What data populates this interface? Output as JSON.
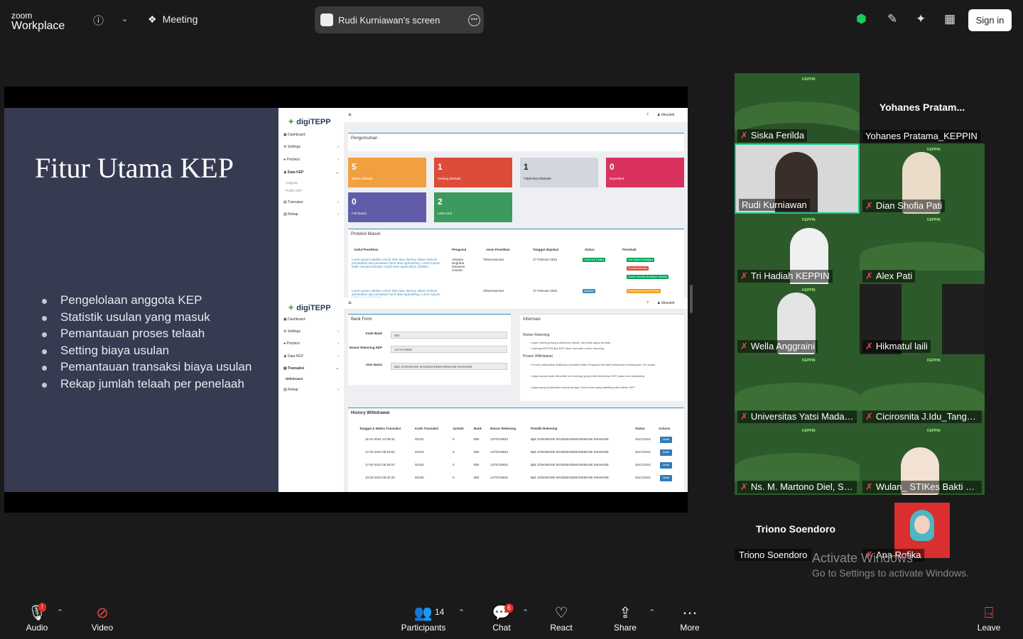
{
  "app": {
    "logo_top": "zoom",
    "logo_bottom": "Workplace"
  },
  "header": {
    "meeting_label": "Meeting",
    "screen_share_label": "Rudi Kurniawan's screen",
    "sign_in": "Sign in"
  },
  "colors": {
    "accent_green": "#1ec95a",
    "active_border": "#20c997",
    "tile_orange": "#f0a040",
    "tile_red": "#dd4b39",
    "tile_gray": "#d2d6de",
    "tile_pink": "#d9325f",
    "tile_purple": "#605ca8",
    "tile_green": "#3c9a5f"
  },
  "slide": {
    "title": "Fitur Utama KEP",
    "bullets": [
      "Pengelolaan anggota KEP",
      "Statistik usulan yang masuk",
      "Pemantauan proses telaah",
      "Setting biaya usulan",
      "Pemantauan transaksi biaya usulan",
      "Rekap jumlah telaah per penelaah"
    ]
  },
  "app1": {
    "brand": "digiTEPP",
    "user": "dinustek",
    "help": "?",
    "nav": [
      "Dashboard",
      "Settings",
      "Protokol",
      "Data KEP",
      "Transaksi",
      "Rekap"
    ],
    "subnav": [
      "Anggota",
      "Profile KEP"
    ],
    "announcement": "Pengumuman",
    "stats": [
      {
        "value": "5",
        "label": "Belum ditelaah"
      },
      {
        "value": "1",
        "label": "Sedang ditelaah"
      },
      {
        "value": "1",
        "label": "Tidak Bisa Ditelaah"
      },
      {
        "value": "0",
        "label": "Expedited"
      },
      {
        "value": "0",
        "label": "Full Board"
      },
      {
        "value": "2",
        "label": "Lolos SLE"
      }
    ],
    "protocol_title": "Protokol Masuk",
    "columns": [
      "Judul Penelitian",
      "Pengusul",
      "Jenis Penelitian",
      "Tanggal diajukan",
      "Status",
      "Penelaah"
    ],
    "rows": [
      {
        "judul": "Lorem ipsum adalah contoh teks atau dummy dalam industri percetakan dan penataan huruf atau typesetting. Lorem Ipsum telah menjadi standar contoh teks sejak tahun 1500an,",
        "pengusul": "Abiyasa Nugraha Siswanto Candra",
        "jenis": "Observasional",
        "tanggal": "17 Februari 2024",
        "status": "Lolos SLE (Telah)",
        "penelaah": [
          "Joko Nijanto Branijaya",
          "Eunanda Birdana",
          "Guntur Gumelar Branijaya Laksana"
        ]
      },
      {
        "judul": "Lorem ipsum adalah contoh teks atau dummy dalam industri percetakan dan penataan huruf atau typesetting. Lorem Ipsum telah menjadi standar",
        "pengusul": "",
        "jenis": "Observasional",
        "tanggal": "17 Februari 2024",
        "status": "Diajukan",
        "penelaah": [
          "Penetapak Belum Di Ploting"
        ]
      }
    ]
  },
  "app2": {
    "brand": "digiTEPP",
    "user": "dinustek",
    "help": "?",
    "nav": [
      "Dashboard",
      "Settings",
      "Protokol",
      "Data KEP",
      "Transaksi",
      "Rekap"
    ],
    "subnav": [
      "Withdrawal"
    ],
    "bank_form": {
      "title": "Bank Form",
      "kode_bank_label": "Kode Bank",
      "kode_bank_value": "BNI",
      "rekening_label": "Nomor Rekening KEP",
      "rekening_value": "1275719933",
      "atas_nama_label": "Atas Nama",
      "atas_nama_value": "Bpk JONOMADE MADEMADEMADEMADE IMAMADE"
    },
    "info": {
      "title": "Informasi",
      "rekening_heading": "Nomor Rekening",
      "rekening_points": [
        "Input rekening hanya dilakukan sekali, dan tidak dapat dirubah",
        "hubungi KEPPIN jika KEP akan merubah nomor rekening"
      ],
      "withdrawal_heading": "Proses Withdrawal",
      "withdrawal_points": [
        "Proses withdrawal dilakukan otomatis ketika Pengusul berhasil melakukan pembayaran VA usulan",
        "biaya usulan akan ditransfer ke rekening yang telah diinputkan KEP pada form disamping",
        "biaya yang di-withdraw sesuai dengan Tarif usulan yang disetting oleh Admin KEP"
      ]
    },
    "history_title": "History Withdrawal",
    "columns": [
      "Tanggal & Waktu Transaksi",
      "Kode Transaksi",
      "Jumlah",
      "Bank",
      "Nomor Rekening",
      "Pemilik Rekening",
      "Status",
      "Actions"
    ],
    "rows": [
      {
        "tanggal": "11-01-2024 12:09:32",
        "kode": "00132",
        "jumlah": "0",
        "bank": "BNI",
        "rek": "1275719933",
        "pemilik": "Bpk JONOMADE MADEMADEMADEMADE IMAMADE",
        "status": "SUCCESS",
        "action": "Detail"
      },
      {
        "tanggal": "17-02-2024 00:18:54",
        "kode": "00133",
        "jumlah": "0",
        "bank": "BNI",
        "rek": "1275719933",
        "pemilik": "Bpk JONOMADE MADEMADEMADEMADE IMAMADE",
        "status": "SUCCESS",
        "action": "Detail"
      },
      {
        "tanggal": "17-02-2024 00:25:57",
        "kode": "00134",
        "jumlah": "0",
        "bank": "BNI",
        "rek": "1275719933",
        "pemilik": "Bpk JONOMADE MADEMADEMADEMADE IMAMADE",
        "status": "SUCCESS",
        "action": "Detail"
      },
      {
        "tanggal": "10-03-2024 09:42:32",
        "kode": "00135",
        "jumlah": "0",
        "bank": "BNI",
        "rek": "1275719933",
        "pemilik": "Bpk JONOMADE MADEMADEMADEMADE IMAMADE",
        "status": "SUCCESS",
        "action": "Detail"
      }
    ]
  },
  "participants": [
    {
      "name": "Siska Ferilda",
      "muted": true,
      "video": true
    },
    {
      "name": "Yohanes Pratama_KEPPIN",
      "big_name": "Yohanes  Pratam...",
      "muted": false,
      "video": false
    },
    {
      "name": "Rudi Kurniawan",
      "muted": false,
      "video": true,
      "active": true
    },
    {
      "name": "Dian Shofia Pati",
      "muted": true,
      "video": true
    },
    {
      "name": "Tri Hadiah KEPPIN",
      "muted": true,
      "video": true
    },
    {
      "name": "Alex  Pati",
      "muted": true,
      "video": true
    },
    {
      "name": "Wella Anggraini",
      "muted": true,
      "video": true
    },
    {
      "name": "Hikmatul laili",
      "muted": true,
      "video": true
    },
    {
      "name": "Universitas Yatsi Madani...",
      "muted": true,
      "video": true
    },
    {
      "name": "Cicirosnita J.Idu_Tangera...",
      "muted": true,
      "video": true
    },
    {
      "name": "Ns. M. Martono Diel, S....",
      "muted": true,
      "video": true
    },
    {
      "name": "Wulan_ STIKes Bakti Uta...",
      "muted": true,
      "video": true
    },
    {
      "name": "Triono Soendoro",
      "big_name": "Triono Soendoro",
      "muted": false,
      "video": false
    },
    {
      "name": "Ana Rofika",
      "muted": true,
      "video": true
    }
  ],
  "watermark": {
    "line1": "Activate Windows",
    "line2": "Go to Settings to activate Windows."
  },
  "toolbar": {
    "audio": "Audio",
    "audio_badge": "!",
    "video": "Video",
    "participants": "Participants",
    "participants_count": "14",
    "chat": "Chat",
    "chat_badge": "6",
    "react": "React",
    "share": "Share",
    "more": "More",
    "leave": "Leave"
  }
}
